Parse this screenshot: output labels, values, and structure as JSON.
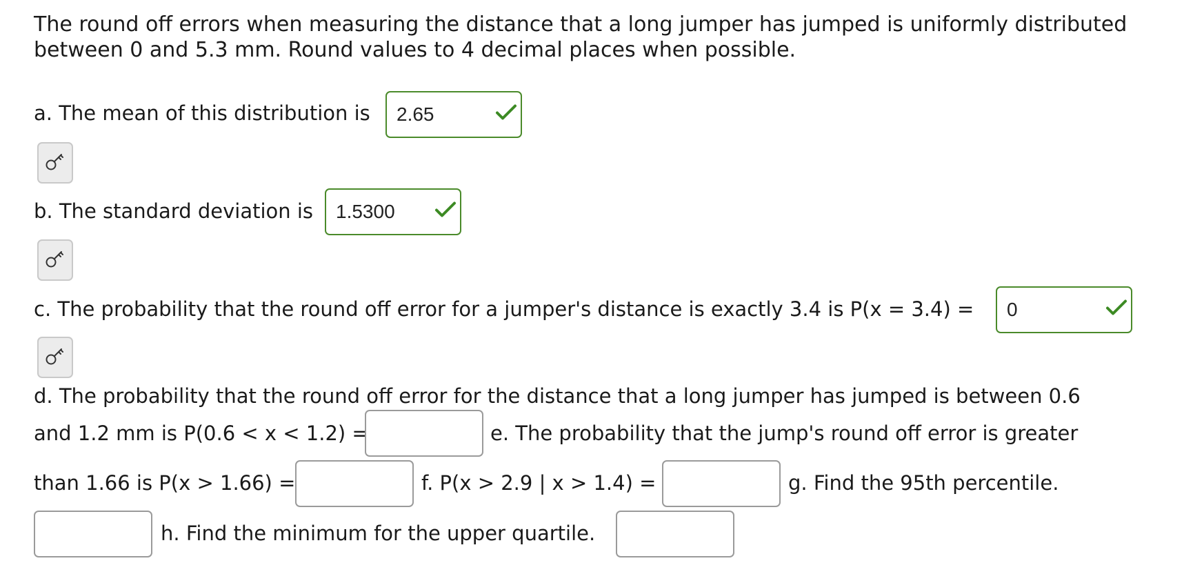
{
  "intro": {
    "line1": "The round off errors when measuring the distance that a long jumper has jumped is uniformly distributed",
    "line2": "between 0 and 5.3 mm. Round values to 4 decimal places when possible."
  },
  "parts": {
    "a": {
      "label": "a. The mean of this distribution is",
      "answer": "2.65",
      "status": "correct"
    },
    "b": {
      "label": "b. The standard deviation is",
      "answer": "1.5300",
      "status": "correct"
    },
    "c": {
      "label": "c. The probability that the round off error for a jumper's distance is exactly 3.4 is P(x = 3.4) =",
      "answer": "0",
      "status": "correct"
    },
    "d": {
      "label_line1": "d. The probability that the round off error for the distance that a long jumper has jumped is between 0.6",
      "label_line2": "and 1.2 mm is P(0.6 < x < 1.2) =",
      "answer": ""
    },
    "e": {
      "label_line1": "e. The probability that the jump's round off error is greater",
      "label_line2": "than 1.66 is P(x > 1.66) =",
      "answer": ""
    },
    "f": {
      "label": "f. P(x > 2.9 | x > 1.4) =",
      "answer": ""
    },
    "g": {
      "label": "g. Find the 95th percentile.",
      "answer": ""
    },
    "h": {
      "label": "h. Find the minimum for the upper quartile.",
      "answer": ""
    }
  },
  "icons": {
    "hint": "key-icon",
    "correct": "checkmark-icon"
  },
  "colors": {
    "correct": "#3c8a23",
    "blank_border": "#9a9a9a",
    "key_button_bg": "#ececec"
  }
}
